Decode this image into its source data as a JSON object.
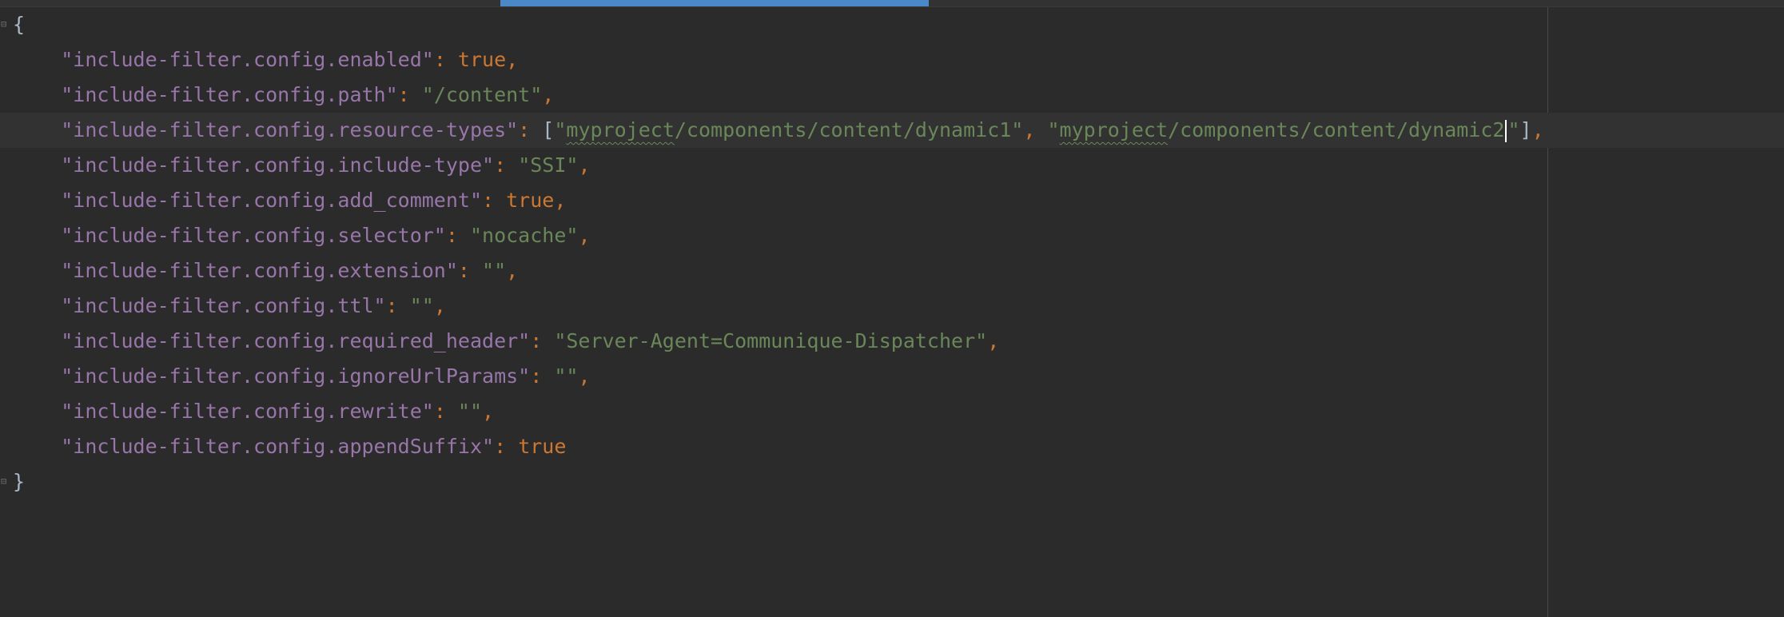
{
  "editor": {
    "colors": {
      "background": "#2b2b2b",
      "key": "#9876aa",
      "string": "#6a8759",
      "keyword": "#cc7832",
      "text": "#a9b7c6",
      "progress": "#4a88c7"
    },
    "progress_fraction": 0.24,
    "open_brace": "{",
    "close_brace": "}",
    "lines": [
      {
        "key": "\"include-filter.config.enabled\"",
        "sep": ": ",
        "value": "true",
        "type": "bool",
        "trail": ","
      },
      {
        "key": "\"include-filter.config.path\"",
        "sep": ": ",
        "value": "\"/content\"",
        "type": "string",
        "trail": ","
      },
      {
        "key": "\"include-filter.config.resource-types\"",
        "sep": ": ",
        "type": "array",
        "array_open": "[",
        "item1_open": "\"",
        "item1_typo": "myproject",
        "item1_rest": "/components/content/dynamic1\"",
        "item_sep": ", ",
        "item2_open": "\"",
        "item2_typo": "myproject",
        "item2_rest": "/components/content/dynamic2",
        "item2_close": "\"",
        "array_close": "]",
        "trail": ","
      },
      {
        "key": "\"include-filter.config.include-type\"",
        "sep": ": ",
        "value": "\"SSI\"",
        "type": "string",
        "trail": ","
      },
      {
        "key": "\"include-filter.config.add_comment\"",
        "sep": ": ",
        "value": "true",
        "type": "bool",
        "trail": ","
      },
      {
        "key": "\"include-filter.config.selector\"",
        "sep": ": ",
        "value": "\"nocache\"",
        "type": "string",
        "trail": ","
      },
      {
        "key": "\"include-filter.config.extension\"",
        "sep": ": ",
        "value": "\"\"",
        "type": "string",
        "trail": ","
      },
      {
        "key": "\"include-filter.config.ttl\"",
        "sep": ": ",
        "value": "\"\"",
        "type": "string",
        "trail": ","
      },
      {
        "key": "\"include-filter.config.required_header\"",
        "sep": ": ",
        "value": "\"Server-Agent=Communique-Dispatcher\"",
        "type": "string",
        "trail": ","
      },
      {
        "key": "\"include-filter.config.ignoreUrlParams\"",
        "sep": ": ",
        "value": "\"\"",
        "type": "string",
        "trail": ","
      },
      {
        "key": "\"include-filter.config.rewrite\"",
        "sep": ": ",
        "value": "\"\"",
        "type": "string",
        "trail": ","
      },
      {
        "key": "\"include-filter.config.appendSuffix\"",
        "sep": ": ",
        "value": "true",
        "type": "bool",
        "trail": ""
      }
    ]
  }
}
